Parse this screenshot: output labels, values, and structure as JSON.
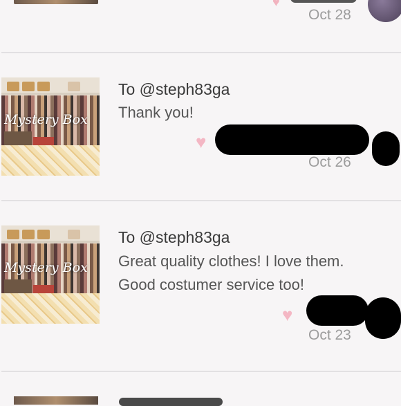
{
  "header_item": {
    "date": "Oct 28"
  },
  "messages": [
    {
      "thumbnail_caption": "Mystery Box",
      "recipient": "To @steph83ga",
      "text_lines": [
        "Thank you!"
      ],
      "date": "Oct 26",
      "heart_icon": "heart-icon"
    },
    {
      "thumbnail_caption": "Mystery Box",
      "recipient": "To @steph83ga",
      "text_lines": [
        "Great quality clothes! I love them.",
        "Good costumer service too!"
      ],
      "date": "Oct 23",
      "heart_icon": "heart-icon"
    }
  ],
  "colors": {
    "background": "#f7f5f6",
    "heart": "#f4b7c4",
    "date": "#9c9c9c",
    "divider": "#e2e0e2"
  }
}
